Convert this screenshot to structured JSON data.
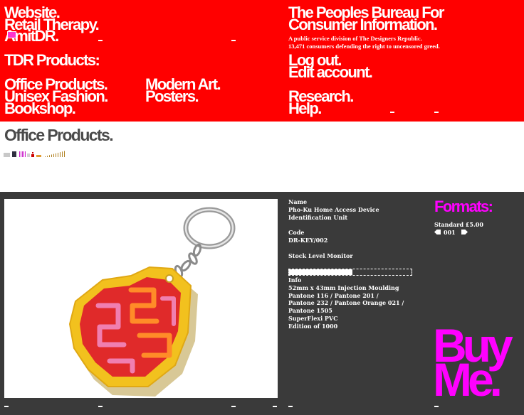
{
  "header": {
    "nav_website": "Website.",
    "nav_retail": "Retail Therapy.",
    "nav_amitdr": "AmitDR.",
    "section_title": "TDR Products:",
    "products": [
      "Office Products.",
      "Unisex Fashion.",
      "Bookshop.",
      "Modern Art.",
      "Posters."
    ],
    "bureau_line1": "The Peoples Bureau For",
    "bureau_line2": "Consumer Information.",
    "bureau_sub1": "A public service division of The Designers Republic.",
    "bureau_sub2": "13,471 consumers defending the right to uncensored greed.",
    "account": [
      "Log out.",
      "Edit account."
    ],
    "help": [
      "Research.",
      "Help."
    ]
  },
  "category": {
    "title": "Office Products."
  },
  "product": {
    "name_label": "Name",
    "name_line1": "Pho-Ku Home Access Device",
    "name_line2": "Identification Unit",
    "code_label": "Code",
    "code_value": "DR-KEY/002",
    "stock_label": "Stock Level Monitor",
    "stock_level": 0.52,
    "info_label": "Info",
    "info_lines": [
      "52mm x 43mm Injection Moulding",
      "Pantone 116 / Pantone 201 /",
      "Pantone 232 / Pantone Orange 021 /",
      "Pantone 1505",
      "SuperFlexi PVC",
      "Edition of 1000"
    ]
  },
  "formats": {
    "title": "Formats:",
    "standard_label": "Standard",
    "standard_price": "£5.00",
    "quantity": "001"
  },
  "buy": {
    "line1": "Buy",
    "line2": "Me."
  },
  "colors": {
    "brand_red": "#ff0000",
    "magenta": "#ff00ff",
    "panel": "#3a3a3a"
  }
}
